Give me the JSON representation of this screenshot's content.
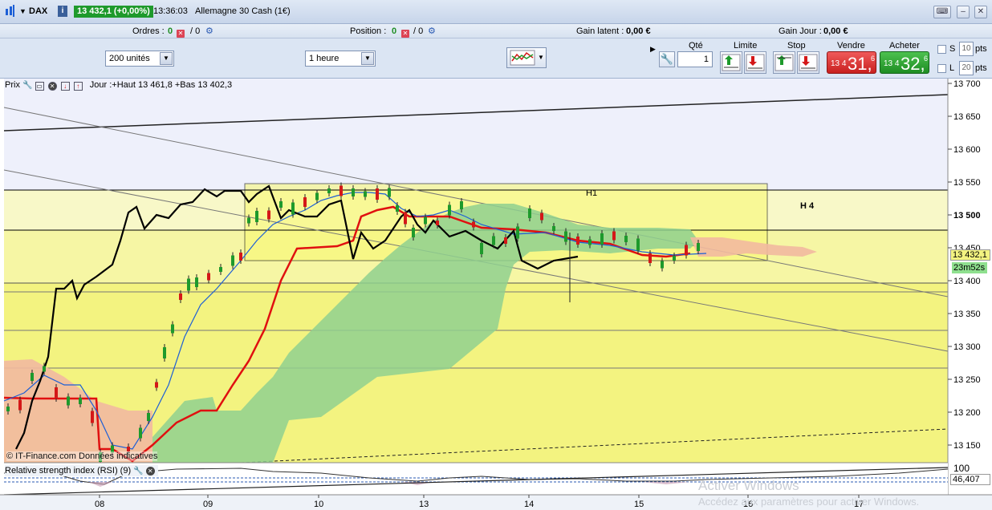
{
  "titlebar": {
    "symbol": "DAX",
    "price_badge": "13 432,1 (+0,00%)",
    "time": "13:36:03",
    "instrument": "Allemagne 30 Cash (1€)"
  },
  "inforow": {
    "orders_label": "Ordres :",
    "orders_value": "0",
    "orders_total": "/ 0",
    "position_label": "Position :",
    "position_value": "0",
    "position_total": "/ 0",
    "gain_latent_label": "Gain latent :",
    "gain_latent_value": "0,00 €",
    "gain_jour_label": "Gain Jour :",
    "gain_jour_value": "0,00 €"
  },
  "toolbar": {
    "units_select": "200 unités",
    "period_select": "1 heure",
    "qty_label": "Qté",
    "qty_value": "1",
    "limit_label": "Limite",
    "stop_label": "Stop",
    "sell_label": "Vendre",
    "buy_label": "Acheter",
    "sell_small": "13 4",
    "sell_big": "31,",
    "sell_sup": "6",
    "buy_small": "13 4",
    "buy_big": "32,",
    "buy_sup": "6",
    "s_label": "S",
    "s_pts": "10",
    "l_label": "L",
    "l_pts": "20",
    "pts_label": "pts"
  },
  "chart": {
    "header_prefix": "Prix",
    "header_text": "Jour :+Haut 13 461,8 +Bas 13 402,3",
    "zone_h1": "H1",
    "zone_h4": "H 4",
    "price_ticks": [
      "13 700",
      "13 650",
      "13 600",
      "13 550",
      "13 500",
      "13 450",
      "13 400",
      "13 350",
      "13 300",
      "13 250",
      "13 200",
      "13 150"
    ],
    "current_price": "13 432,1",
    "countdown": "23m52s",
    "date_labels": [
      "08",
      "09",
      "10",
      "13",
      "14",
      "15",
      "16",
      "17"
    ],
    "copyright": "© IT-Finance.com  Données indicatives",
    "rsi_header": "Relative strength index (RSI) (9)",
    "rsi_top": "100",
    "rsi_value": "46,407",
    "watermark_title": "Activer Windows",
    "watermark_text": "Accédez aux paramètres pour activer Windows.",
    "colors": {
      "bull_candle": "#1e9a2c",
      "bear_candle": "#d41818",
      "kijun": "#e01010",
      "tenkan": "#1d5fd6",
      "chikou": "#000000",
      "cloud_bull": "#8fd08f",
      "cloud_bear": "#f2b9a0",
      "zone_fill": "#f3f380"
    }
  }
}
